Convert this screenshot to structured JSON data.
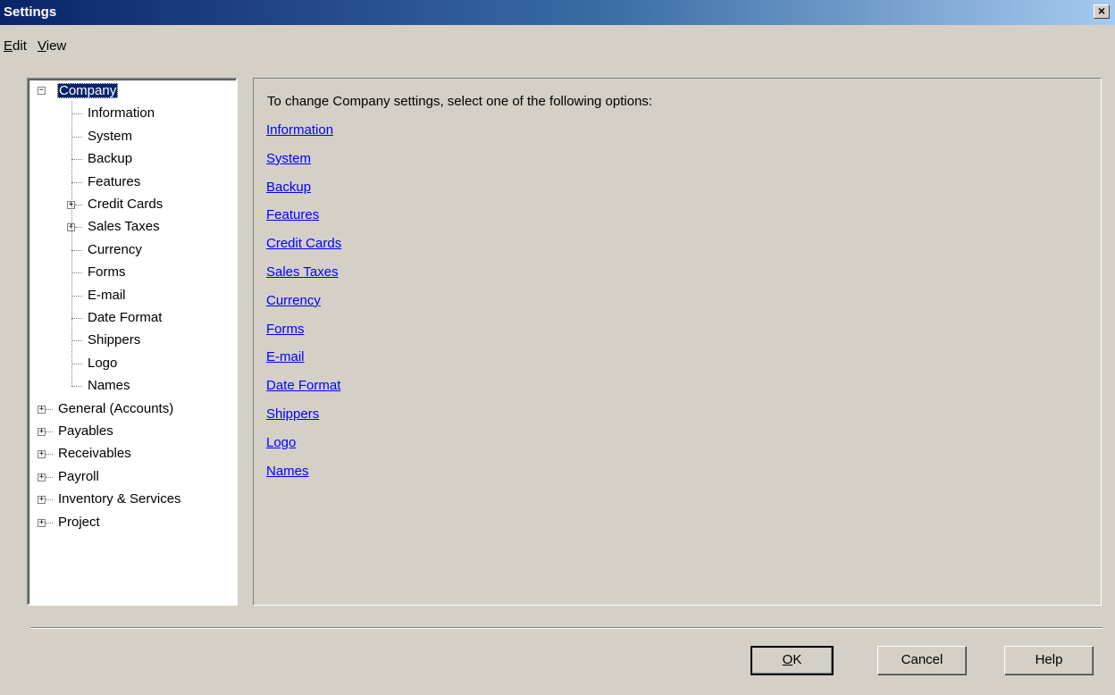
{
  "window": {
    "title": "Settings",
    "close_icon": "close-icon"
  },
  "menu": {
    "edit": {
      "accel": "E",
      "rest": "dit"
    },
    "view": {
      "accel": "V",
      "rest": "iew"
    }
  },
  "tree": {
    "company": "Company",
    "children": [
      "Information",
      "System",
      "Backup",
      "Features",
      "Credit Cards",
      "Sales Taxes",
      "Currency",
      "Forms",
      "E-mail",
      "Date Format",
      "Shippers",
      "Logo",
      "Names"
    ],
    "expandable_children": [
      "Credit Cards",
      "Sales Taxes"
    ],
    "roots": [
      "General (Accounts)",
      "Payables",
      "Receivables",
      "Payroll",
      "Inventory & Services",
      "Project"
    ],
    "expander_collapsed": "+",
    "expander_expanded": "−"
  },
  "content": {
    "intro": "To change Company settings, select one of the following options:",
    "links": [
      "Information",
      "System",
      "Backup",
      "Features",
      "Credit Cards",
      "Sales Taxes",
      "Currency",
      "Forms",
      "E-mail",
      "Date Format",
      "Shippers",
      "Logo",
      "Names"
    ]
  },
  "buttons": {
    "ok": {
      "accel": "O",
      "rest": "K"
    },
    "cancel": "Cancel",
    "help": "Help"
  },
  "colors": {
    "link": "#0000ff",
    "selection": "#0a246a",
    "face": "#d4d0c8"
  }
}
